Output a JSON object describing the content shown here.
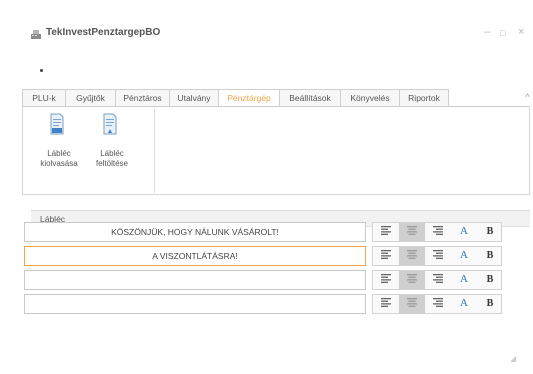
{
  "app": {
    "title": "TekInvestPenztargepBO",
    "controls": {
      "minimize": "–",
      "maximize": "□",
      "close": "×"
    }
  },
  "tabs": [
    {
      "label": "PLU-k"
    },
    {
      "label": "Gyűjtők"
    },
    {
      "label": "Pénztáros"
    },
    {
      "label": "Utalvány"
    },
    {
      "label": "Pénztárgép",
      "active": true
    },
    {
      "label": "Beállítások"
    },
    {
      "label": "Könyvelés"
    },
    {
      "label": "Riportok"
    }
  ],
  "ribbon": {
    "read_label": "Lábléc\nkiolvasása",
    "write_label": "Lábléc\nfeltöltése"
  },
  "section": {
    "title": "Lábléc"
  },
  "footer_lines": [
    {
      "value": "KÖSZÖNJÜK, HOGY NÁLUNK VÁSÁROLT!",
      "focused": false
    },
    {
      "value": "A VISZONTLÁTÁSRA!",
      "focused": true
    },
    {
      "value": "",
      "focused": false
    },
    {
      "value": "",
      "focused": false
    }
  ],
  "format_buttons": {
    "font": "A",
    "bold": "B"
  },
  "colors": {
    "accent": "#f0a64b",
    "text": "#555555",
    "border": "#c8c8c8"
  }
}
